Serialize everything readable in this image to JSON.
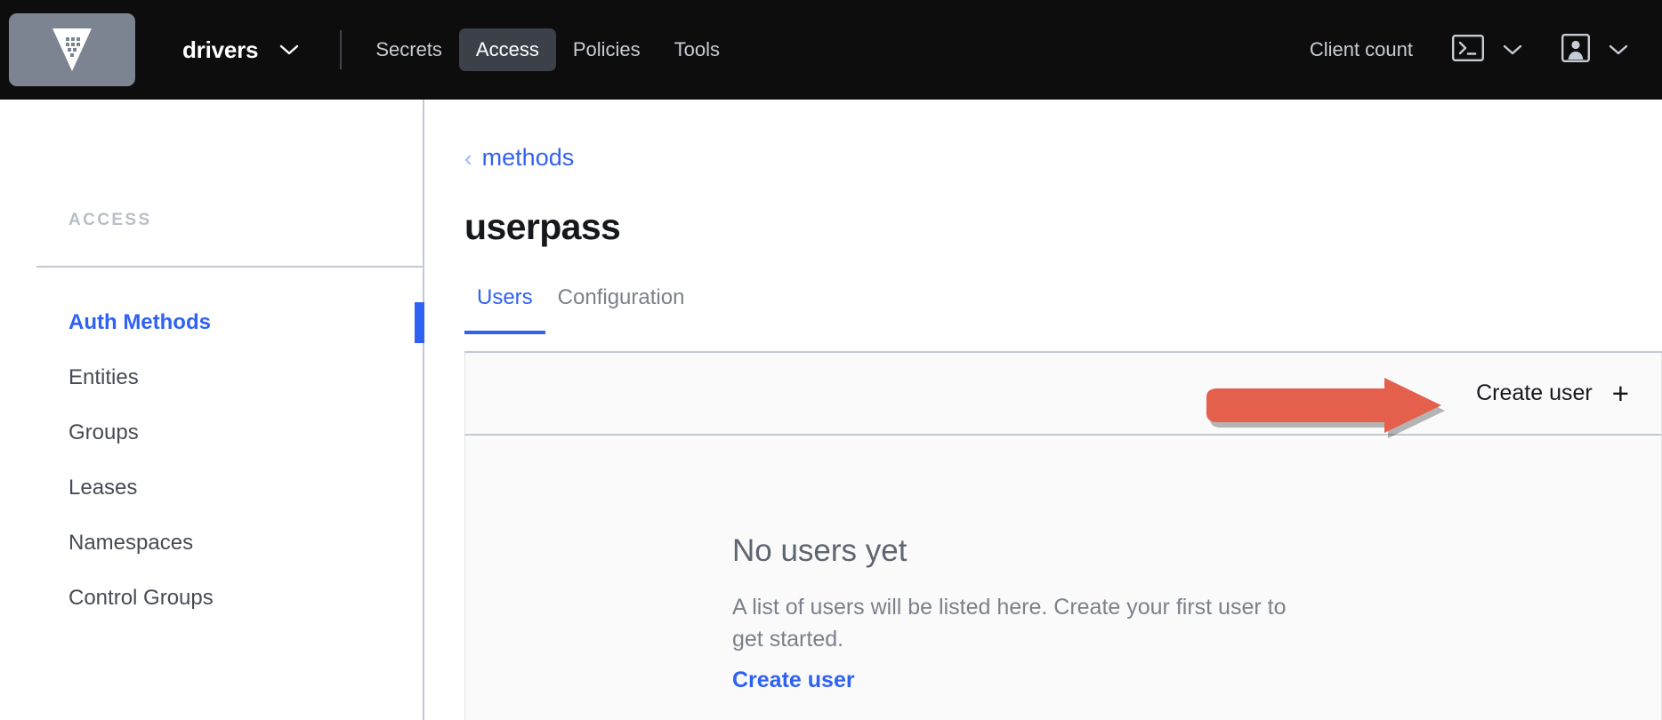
{
  "header": {
    "logo_icon": "vault-logo-icon",
    "namespace": "drivers",
    "namespace_chevron_icon": "chevron-down-icon",
    "nav_items": [
      {
        "label": "Secrets",
        "active": false
      },
      {
        "label": "Access",
        "active": true
      },
      {
        "label": "Policies",
        "active": false
      },
      {
        "label": "Tools",
        "active": false
      }
    ],
    "client_count_label": "Client count",
    "console_icon": "console-terminal-icon",
    "console_chevron_icon": "chevron-down-icon",
    "user_icon": "user-account-icon",
    "user_chevron_icon": "chevron-down-icon"
  },
  "sidebar": {
    "heading": "ACCESS",
    "items": [
      {
        "label": "Auth Methods",
        "active": true
      },
      {
        "label": "Entities",
        "active": false
      },
      {
        "label": "Groups",
        "active": false
      },
      {
        "label": "Leases",
        "active": false
      },
      {
        "label": "Namespaces",
        "active": false
      },
      {
        "label": "Control Groups",
        "active": false
      }
    ]
  },
  "main": {
    "breadcrumb": {
      "chevron_icon": "chevron-left-icon",
      "chevron_glyph": "‹",
      "label": "methods"
    },
    "page_title": "userpass",
    "tabs": [
      {
        "label": "Users",
        "active": true
      },
      {
        "label": "Configuration",
        "active": false
      }
    ],
    "toolbar": {
      "create_user_label": "Create user",
      "create_user_plus_glyph": "+",
      "plus_icon": "plus-icon"
    },
    "empty_state": {
      "title": "No users yet",
      "description": "A list of users will be listed here. Create your first user to get started.",
      "link_label": "Create user"
    }
  },
  "annotation": {
    "arrow_icon": "red-pointer-arrow",
    "color": "#e4604d",
    "direction": "right"
  },
  "colors": {
    "header_bg": "#0d0d0e",
    "accent_blue": "#2f62f4",
    "logo_tile": "#7d8491",
    "nav_active_bg": "#3b4049",
    "panel_bg": "#fafafa",
    "border": "#c3c8d1"
  }
}
